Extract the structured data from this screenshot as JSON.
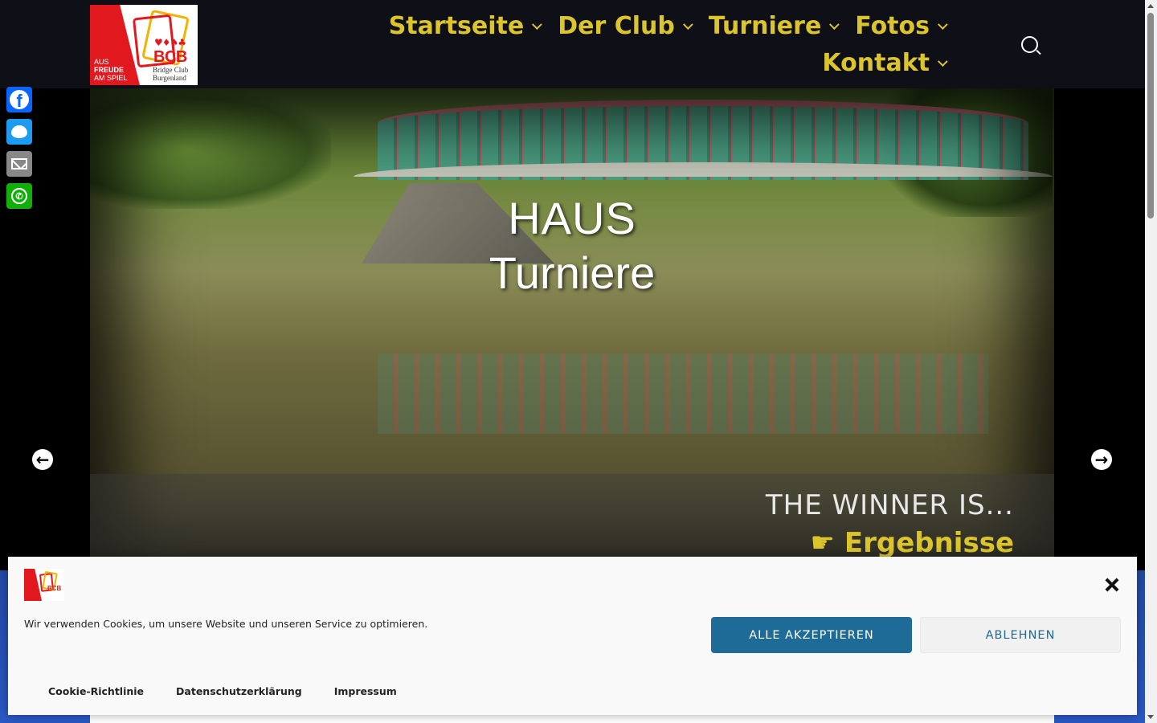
{
  "header": {
    "logo": {
      "slogan": [
        "AUS",
        "FREUDE",
        "AM SPIEL"
      ],
      "brand": "BCB",
      "subtitle": [
        "Bridge Club",
        "Burgenland"
      ],
      "suits": "♥♦♠♣"
    },
    "nav": [
      {
        "label": "Startseite"
      },
      {
        "label": "Der Club"
      },
      {
        "label": "Turniere"
      },
      {
        "label": "Fotos"
      },
      {
        "label": "Kontakt"
      }
    ],
    "search_icon": "search-icon",
    "colors": {
      "nav_text": "#dcc52c",
      "header_bg": "#0f0f18"
    }
  },
  "share": [
    {
      "name": "Facebook",
      "icon": "facebook-icon",
      "color": "#0866ff"
    },
    {
      "name": "Twitter",
      "icon": "twitter-icon",
      "color": "#1d9bf0"
    },
    {
      "name": "Email",
      "icon": "email-icon",
      "color": "#888888"
    },
    {
      "name": "WhatsApp",
      "icon": "whatsapp-icon",
      "color": "#12af0a"
    }
  ],
  "slider": {
    "title_line1": "HAUS",
    "title_line2": "Turniere",
    "caption_kicker": "THE WINNER IS...",
    "caption_link_icon": "☛",
    "caption_link": "Ergebnisse",
    "prev_arrow": "←",
    "next_arrow": "→"
  },
  "cookie": {
    "message": "Wir verwenden Cookies, um unsere Website und unseren Service zu optimieren.",
    "accept": "ALLE AKZEPTIEREN",
    "deny": "ABLEHNEN",
    "links": [
      "Cookie-Richtlinie",
      "Datenschutzerklärung",
      "Impressum"
    ],
    "accent": "#1f6b98"
  }
}
